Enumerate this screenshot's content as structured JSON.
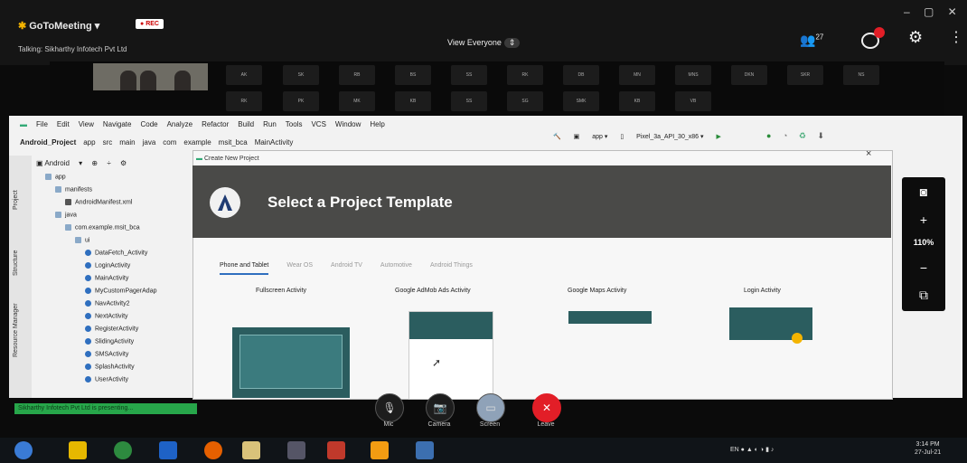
{
  "meeting": {
    "app_name": "GoToMeeting",
    "rec_label": "REC",
    "talking": "Talking: Sikharthy Infotech Pvt Ltd",
    "view_label": "View Everyone",
    "participant_count": "27",
    "accent": "#e21e27"
  },
  "strip": {
    "row1": [
      "AK",
      "SK",
      "RB",
      "BS",
      "SS",
      "RK",
      "DB",
      "MN",
      "MNS",
      "DKN",
      "SKR",
      "NS"
    ],
    "row2": [
      "RK",
      "PK",
      "MK",
      "KB",
      "SS",
      "SG",
      "SMK",
      "KB",
      "VB"
    ]
  },
  "ide": {
    "menu": [
      "File",
      "Edit",
      "View",
      "Navigate",
      "Code",
      "Analyze",
      "Refactor",
      "Build",
      "Run",
      "Tools",
      "VCS",
      "Window",
      "Help"
    ],
    "breadcrumbs": [
      "Android_Project",
      "app",
      "src",
      "main",
      "java",
      "com",
      "example",
      "msit_bca",
      "MainActivity"
    ],
    "run_config": "app",
    "device": "Pixel_3a_API_30_x86",
    "project_view": "Android",
    "side_tabs": [
      "Project",
      "Structure",
      "Resource Manager"
    ],
    "tree": [
      {
        "label": "app",
        "depth": 0,
        "type": "dir"
      },
      {
        "label": "manifests",
        "depth": 1,
        "type": "dir"
      },
      {
        "label": "AndroidManifest.xml",
        "depth": 2,
        "type": "file"
      },
      {
        "label": "java",
        "depth": 1,
        "type": "dir"
      },
      {
        "label": "com.example.msit_bca",
        "depth": 2,
        "type": "dir"
      },
      {
        "label": "ui",
        "depth": 3,
        "type": "dir"
      },
      {
        "label": "DataFetch_Activity",
        "depth": 4,
        "type": "cls"
      },
      {
        "label": "LoginActivity",
        "depth": 4,
        "type": "cls"
      },
      {
        "label": "MainActivity",
        "depth": 4,
        "type": "cls"
      },
      {
        "label": "MyCustomPagerAdap",
        "depth": 4,
        "type": "cls"
      },
      {
        "label": "NavActivity2",
        "depth": 4,
        "type": "cls"
      },
      {
        "label": "NextActivity",
        "depth": 4,
        "type": "cls"
      },
      {
        "label": "RegisterActivity",
        "depth": 4,
        "type": "cls"
      },
      {
        "label": "SlidingActivity",
        "depth": 4,
        "type": "cls"
      },
      {
        "label": "SMSActivity",
        "depth": 4,
        "type": "cls"
      },
      {
        "label": "SplashActivity",
        "depth": 4,
        "type": "cls"
      },
      {
        "label": "UserActivity",
        "depth": 4,
        "type": "cls"
      }
    ]
  },
  "dialog": {
    "window_title": "Create New Project",
    "heading": "Select a Project Template",
    "tabs": [
      "Phone and Tablet",
      "Wear OS",
      "Android TV",
      "Automotive",
      "Android Things"
    ],
    "active_tab": "Phone and Tablet",
    "templates": [
      "Fullscreen Activity",
      "Google AdMob Ads Activity",
      "Google Maps Activity",
      "Login Activity"
    ]
  },
  "zoom": {
    "value": "110%"
  },
  "presenting": "Sikharthy Infotech Pvt Ltd is presenting...",
  "controls": {
    "mic": "Mic",
    "camera": "Camera",
    "screen": "Screen",
    "leave": "Leave"
  },
  "taskbar": {
    "time": "3:14 PM",
    "date": "27-Jul-21",
    "lang": "EN"
  }
}
